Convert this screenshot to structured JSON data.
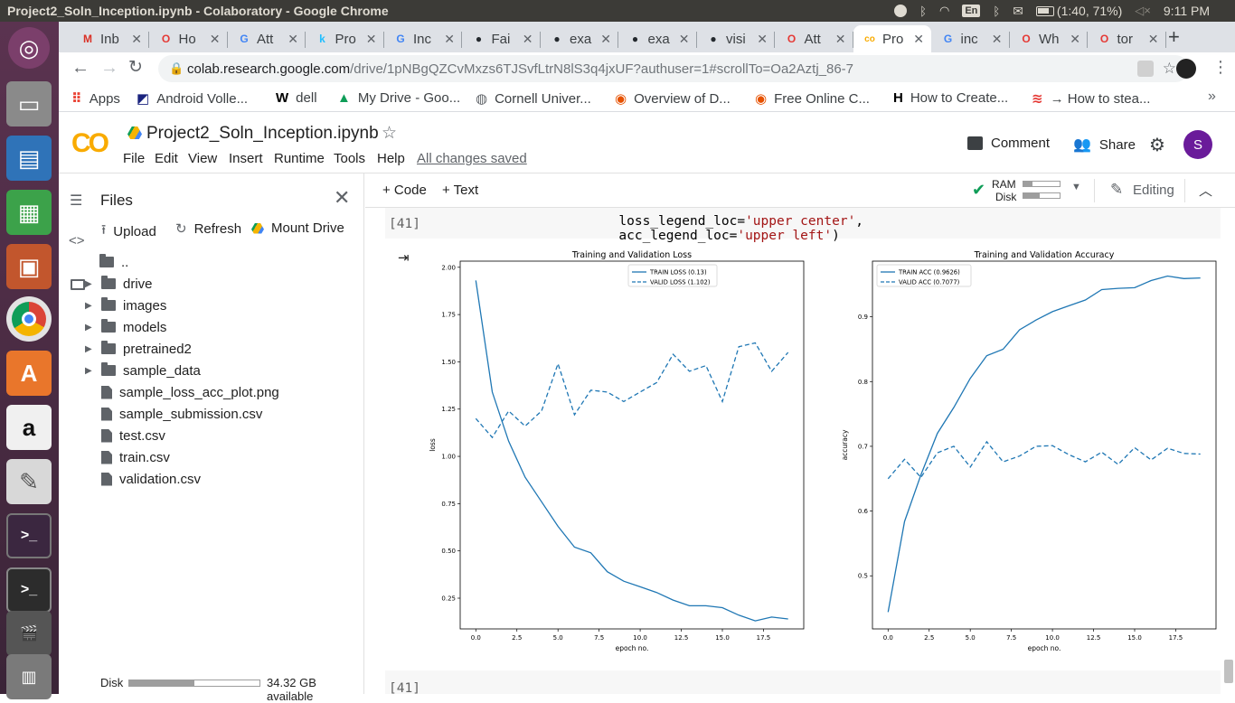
{
  "os": {
    "window_title": "Project2_Soln_Inception.ipynb - Colaboratory - Google Chrome",
    "kbd_layout": "En",
    "battery": "(1:40, 71%)",
    "clock": "9:11 PM"
  },
  "browser": {
    "tabs": [
      {
        "icon": "gmail-icon",
        "label": "Inb",
        "color": "#d93025"
      },
      {
        "icon": "opera-icon",
        "label": "Ho",
        "color": "#e53935"
      },
      {
        "icon": "google-icon",
        "label": "Att",
        "color": "#4285f4"
      },
      {
        "icon": "kaggle-icon",
        "label": "Pro",
        "color": "#20beff"
      },
      {
        "icon": "google-icon",
        "label": "Inc",
        "color": "#4285f4"
      },
      {
        "icon": "github-icon",
        "label": "Fai",
        "color": "#24292e"
      },
      {
        "icon": "github-icon",
        "label": "exa",
        "color": "#24292e"
      },
      {
        "icon": "github-icon",
        "label": "exa",
        "color": "#24292e"
      },
      {
        "icon": "github-icon",
        "label": "visi",
        "color": "#24292e"
      },
      {
        "icon": "opera-icon",
        "label": "Att",
        "color": "#e53935"
      },
      {
        "icon": "colab-icon",
        "label": "Pro",
        "color": "#f9ab00",
        "active": true
      },
      {
        "icon": "google-icon",
        "label": "inc",
        "color": "#4285f4"
      },
      {
        "icon": "opera-icon",
        "label": "Wh",
        "color": "#e53935"
      },
      {
        "icon": "opera-icon",
        "label": "tor",
        "color": "#e53935"
      }
    ],
    "url_host": "colab.research.google.com",
    "url_path": "/drive/1pNBgQZCvMxzs6TJSvfLtrN8lS3q4jxUF?authuser=1#scrollTo=Oa2Aztj_86-7",
    "bookmarks": [
      {
        "icon": "apps-icon",
        "label": "Apps"
      },
      {
        "icon": "android-icon",
        "label": "Android Volle..."
      },
      {
        "icon": "wikipedia-icon",
        "label": "dell"
      },
      {
        "icon": "drive-icon",
        "label": "My Drive - Goo..."
      },
      {
        "icon": "globe-icon",
        "label": "Cornell Univer..."
      },
      {
        "icon": "udemy-icon",
        "label": "Overview of D..."
      },
      {
        "icon": "udemy-icon",
        "label": "Free Online C..."
      },
      {
        "icon": "htg-icon",
        "label": "How to Create..."
      },
      {
        "icon": "feed-icon",
        "label": "→ How to stea..."
      }
    ]
  },
  "colab": {
    "notebook_title": "Project2_Soln_Inception.ipynb",
    "menus": [
      "File",
      "Edit",
      "View",
      "Insert",
      "Runtime",
      "Tools",
      "Help"
    ],
    "saved_status": "All changes saved",
    "comment_label": "Comment",
    "share_label": "Share",
    "avatar_letter": "S",
    "add_code_label": "+ Code",
    "add_text_label": "+ Text",
    "ram_label": "RAM",
    "disk_label": "Disk",
    "editing_label": "Editing"
  },
  "files": {
    "title": "Files",
    "upload_label": "Upload",
    "refresh_label": "Refresh",
    "mount_label": "Mount Drive",
    "entries": [
      {
        "type": "parent",
        "name": ".."
      },
      {
        "type": "folder",
        "name": "drive"
      },
      {
        "type": "folder",
        "name": "images"
      },
      {
        "type": "folder",
        "name": "models"
      },
      {
        "type": "folder",
        "name": "pretrained2"
      },
      {
        "type": "folder",
        "name": "sample_data"
      },
      {
        "type": "file",
        "name": "sample_loss_acc_plot.png"
      },
      {
        "type": "file",
        "name": "sample_submission.csv"
      },
      {
        "type": "file",
        "name": "test.csv"
      },
      {
        "type": "file",
        "name": "train.csv"
      },
      {
        "type": "file",
        "name": "validation.csv"
      }
    ],
    "disk_label": "Disk",
    "disk_available": "34.32 GB available",
    "disk_used_fraction": 0.5
  },
  "cell": {
    "exec_count": "[41]",
    "code_line1_a": "loss_legend_loc=",
    "code_line1_b": "'upper center'",
    "code_line1_c": ",",
    "code_line2_a": "acc_legend_loc=",
    "code_line2_b": "'upper left'",
    "code_line2_c": ")",
    "next_exec_count": "[41]"
  },
  "chart_data": [
    {
      "type": "line",
      "title": "Training and Validation Loss",
      "xlabel": "epoch no.",
      "ylabel": "loss",
      "xlim": [
        -0.95,
        19.95
      ],
      "ylim": [
        0.0875,
        2.0325
      ],
      "xticks": [
        "0.0",
        "2.5",
        "5.0",
        "7.5",
        "10.0",
        "12.5",
        "15.0",
        "17.5"
      ],
      "xtick_values": [
        0,
        2.5,
        5,
        7.5,
        10,
        12.5,
        15,
        17.5
      ],
      "yticks": [
        "0.25",
        "0.50",
        "0.75",
        "1.00",
        "1.25",
        "1.50",
        "1.75",
        "2.00"
      ],
      "ytick_values": [
        0.25,
        0.5,
        0.75,
        1.0,
        1.25,
        1.5,
        1.75,
        2.0
      ],
      "legend_loc": "upper center",
      "x": [
        0,
        1,
        2,
        3,
        4,
        5,
        6,
        7,
        8,
        9,
        10,
        11,
        12,
        13,
        14,
        15,
        16,
        17,
        18,
        19
      ],
      "series": [
        {
          "name": "TRAIN LOSS (0.13)",
          "style": "solid",
          "values": [
            1.93,
            1.34,
            1.08,
            0.89,
            0.76,
            0.63,
            0.52,
            0.49,
            0.39,
            0.34,
            0.31,
            0.28,
            0.24,
            0.21,
            0.21,
            0.2,
            0.16,
            0.13,
            0.15,
            0.14
          ]
        },
        {
          "name": "VALID LOSS (1.102)",
          "style": "dashed",
          "values": [
            1.2,
            1.1,
            1.24,
            1.16,
            1.24,
            1.49,
            1.22,
            1.35,
            1.34,
            1.29,
            1.34,
            1.39,
            1.54,
            1.45,
            1.48,
            1.29,
            1.58,
            1.6,
            1.45,
            1.55
          ]
        }
      ]
    },
    {
      "type": "line",
      "title": "Training and Validation Accuracy",
      "xlabel": "epoch no.",
      "ylabel": "accuracy",
      "xlim": [
        -0.95,
        19.95
      ],
      "ylim": [
        0.418,
        0.986
      ],
      "xticks": [
        "0.0",
        "2.5",
        "5.0",
        "7.5",
        "10.0",
        "12.5",
        "15.0",
        "17.5"
      ],
      "xtick_values": [
        0,
        2.5,
        5,
        7.5,
        10,
        12.5,
        15,
        17.5
      ],
      "yticks": [
        "0.5",
        "0.6",
        "0.7",
        "0.8",
        "0.9"
      ],
      "ytick_values": [
        0.5,
        0.6,
        0.7,
        0.8,
        0.9
      ],
      "legend_loc": "upper left",
      "x": [
        0,
        1,
        2,
        3,
        4,
        5,
        6,
        7,
        8,
        9,
        10,
        11,
        12,
        13,
        14,
        15,
        16,
        17,
        18,
        19
      ],
      "series": [
        {
          "name": "TRAIN ACC (0.9626)",
          "style": "solid",
          "values": [
            0.444,
            0.584,
            0.656,
            0.72,
            0.76,
            0.805,
            0.84,
            0.85,
            0.88,
            0.895,
            0.908,
            0.917,
            0.926,
            0.942,
            0.944,
            0.945,
            0.956,
            0.963,
            0.959,
            0.96
          ]
        },
        {
          "name": "VALID ACC (0.7077)",
          "style": "dashed",
          "values": [
            0.65,
            0.68,
            0.652,
            0.69,
            0.7,
            0.668,
            0.707,
            0.676,
            0.685,
            0.7,
            0.701,
            0.687,
            0.676,
            0.691,
            0.672,
            0.698,
            0.679,
            0.697,
            0.689,
            0.688
          ]
        }
      ]
    }
  ]
}
